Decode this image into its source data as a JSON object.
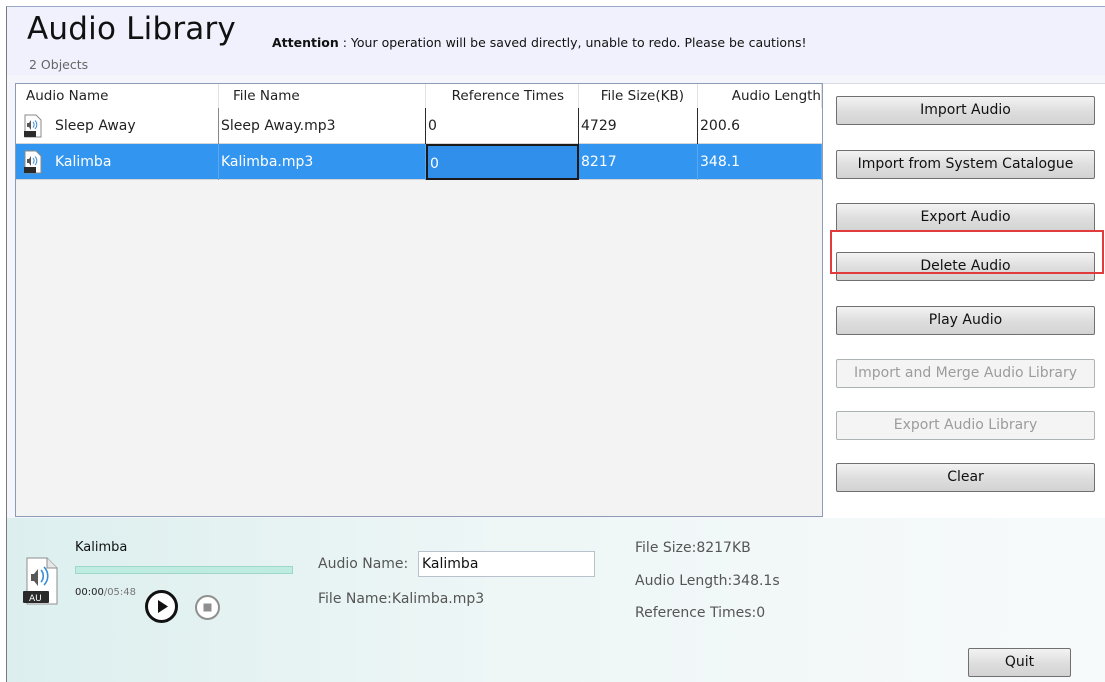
{
  "header": {
    "title": "Audio Library",
    "attention_label": "Attention",
    "attention_text": ": Your operation will be saved directly, unable to redo. Please be cautions!",
    "object_count": "2 Objects"
  },
  "table": {
    "columns": [
      "Audio Name",
      "File Name",
      "Reference Times",
      "File Size(KB)",
      "Audio Length"
    ],
    "rows": [
      [
        "Sleep Away",
        "Sleep Away.mp3",
        "0",
        "4729",
        "200.6"
      ],
      [
        "Kalimba",
        "Kalimba.mp3",
        "0",
        "8217",
        "348.1"
      ]
    ],
    "selected_row": 1
  },
  "actions": {
    "import_audio": "Import Audio",
    "import_system": "Import from System Catalogue",
    "export_audio": "Export Audio",
    "delete_audio": "Delete Audio",
    "play_audio": "Play Audio",
    "import_merge": "Import and Merge Audio Library",
    "export_library": "Export Audio Library",
    "clear": "Clear"
  },
  "player": {
    "title": "Kalimba",
    "icon_badge": "AU",
    "time_current": "00:00",
    "time_total": "/05:48",
    "progress": 0
  },
  "details": {
    "audio_name_label": "Audio Name:",
    "audio_name_value": "Kalimba",
    "file_name": "File Name:Kalimba.mp3",
    "file_size": "File Size:8217KB",
    "audio_length": "Audio Length:348.1s",
    "reference_times": "Reference Times:0"
  },
  "footer": {
    "quit": "Quit"
  },
  "colors": {
    "selection": "#3296f0",
    "highlight_box": "#e23b3b",
    "header_bg": "#f0f1fc",
    "progress_track": "#bfece0"
  }
}
